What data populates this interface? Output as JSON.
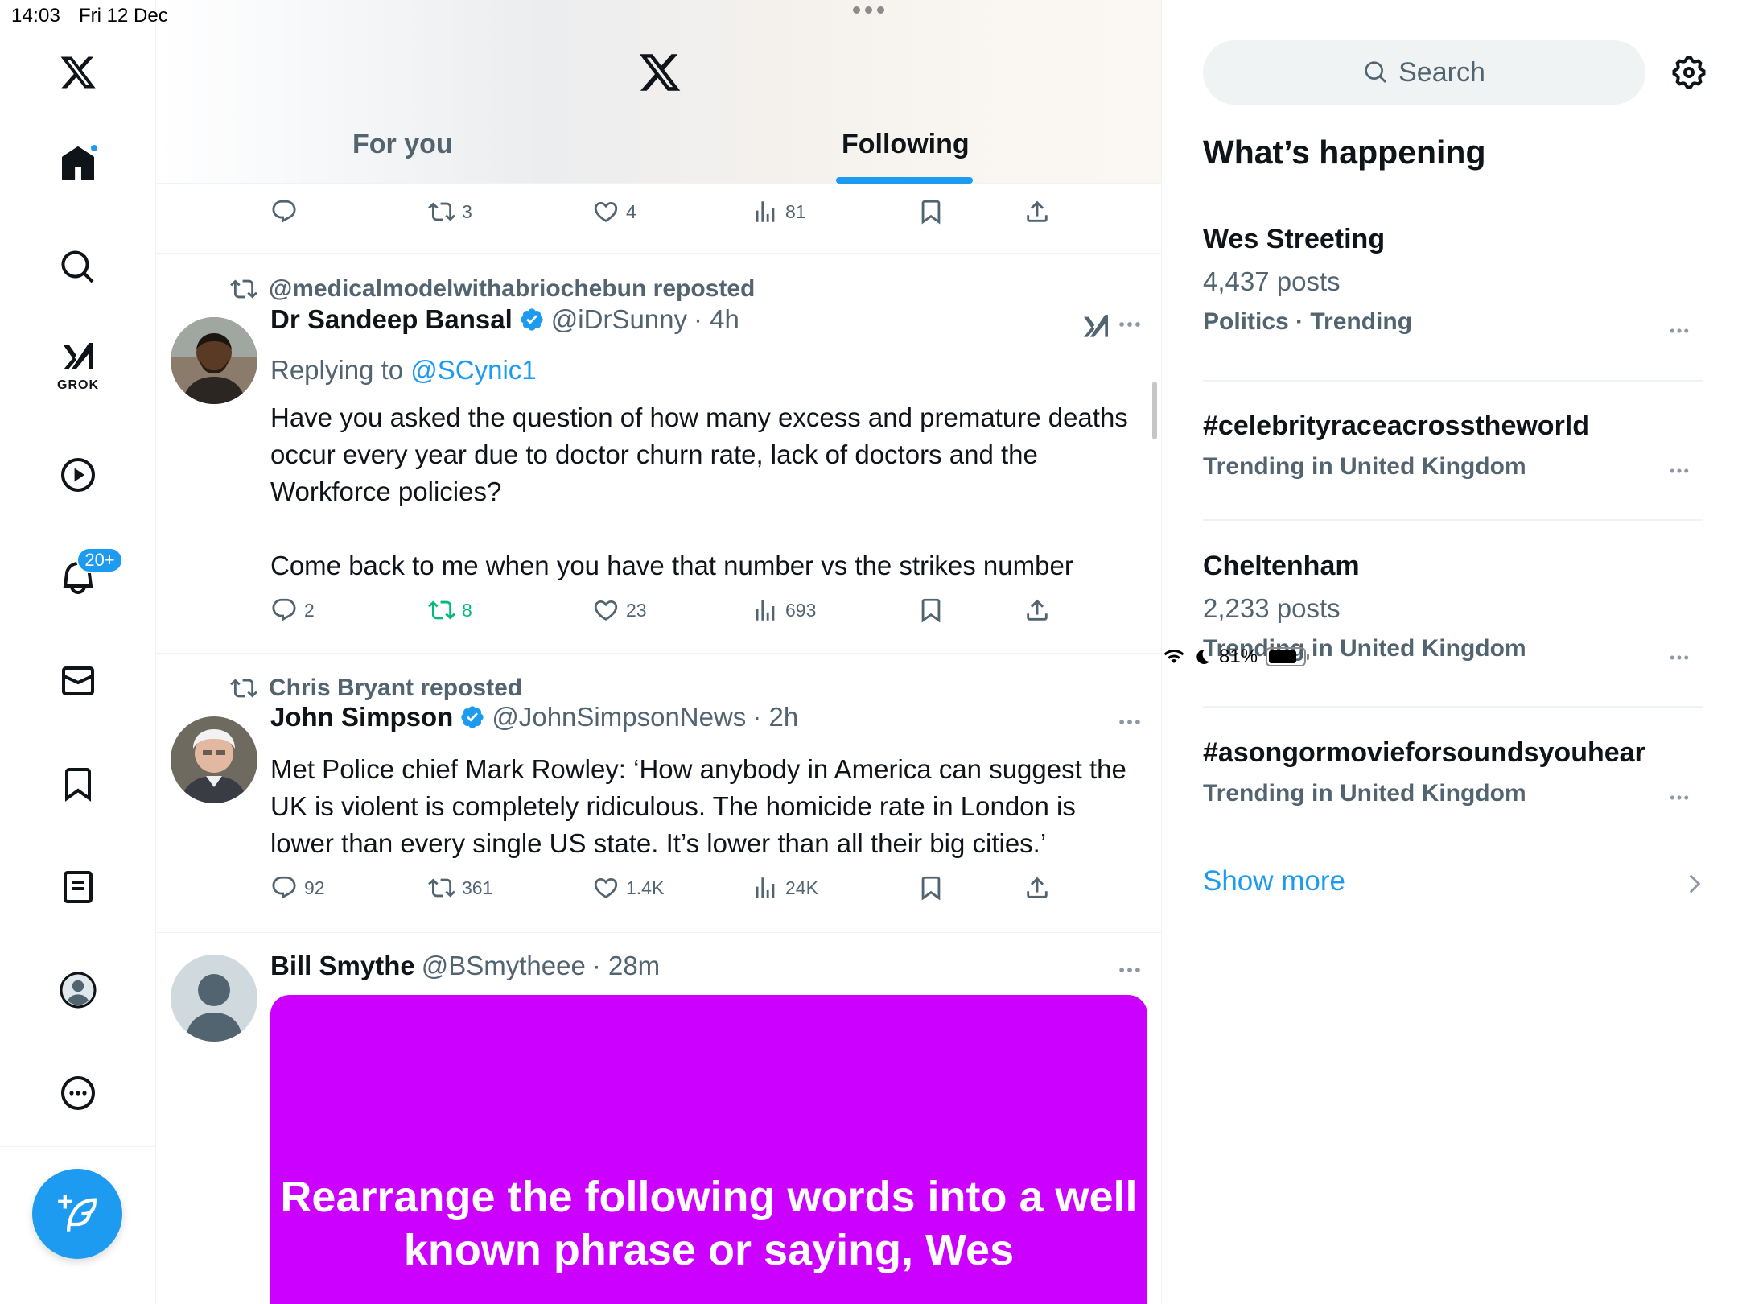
{
  "status_bar": {
    "time": "14:03",
    "date": "Fri 12 Dec",
    "battery": "81%",
    "battery_fraction": 0.81
  },
  "left_nav": {
    "items": [
      "x-logo",
      "home",
      "explore",
      "grok",
      "video",
      "notifications",
      "messages",
      "bookmarks",
      "lists",
      "profile",
      "more"
    ],
    "grok_label": "GROK",
    "notifications_badge": "20+",
    "home_has_dot": true
  },
  "timeline_header": {
    "tabs": [
      {
        "label": "For you",
        "active": false
      },
      {
        "label": "Following",
        "active": true
      }
    ]
  },
  "top_actions": {
    "replies": "",
    "reposts": "3",
    "likes": "4",
    "views": "81"
  },
  "tweets": [
    {
      "reposted_by": "@medicalmodelwithabriochebun reposted",
      "name": "Dr Sandeep Bansal",
      "handle": "@iDrSunny",
      "time": "· 4h",
      "replying_prefix": "Replying to ",
      "replying_to": "@SCynic1",
      "text": "Have you asked the question of how many excess and premature deaths occur every year due to doctor churn rate, lack of doctors and the Workforce policies?\n\nCome back to me when you have that number vs the strikes number",
      "replies": "2",
      "reposts": "8",
      "likes": "23",
      "views": "693"
    },
    {
      "reposted_by": "Chris Bryant reposted",
      "name": "John Simpson",
      "handle": "@JohnSimpsonNews",
      "time": "· 2h",
      "text": "Met Police chief Mark Rowley: ‘How anybody in America can suggest the UK is violent is completely ridiculous. The homicide rate in London is lower than every single US state. It’s lower than all their big cities.’",
      "replies": "92",
      "reposts": "361",
      "likes": "1.4K",
      "views": "24K"
    },
    {
      "name": "Bill Smythe",
      "handle": "@BSmytheee",
      "time": "· 28m",
      "media_text": "Rearrange the following words into a well known phrase or saying, Wes",
      "media_color": "#cc00ff"
    }
  ],
  "sidebar": {
    "search_placeholder": "Search",
    "section_title": "What’s happening",
    "trends": [
      {
        "name": "Wes Streeting",
        "count": "4,437 posts",
        "context": "Politics · Trending"
      },
      {
        "name": "#celebrityraceacrosstheworld",
        "count": "",
        "context": "Trending in United Kingdom"
      },
      {
        "name": "Cheltenham",
        "count": "2,233 posts",
        "context": "Trending in United Kingdom"
      },
      {
        "name": "#asongormovieforsoundsyouhear",
        "count": "",
        "context": "Trending in United Kingdom"
      }
    ],
    "show_more": "Show more"
  },
  "colors": {
    "accent": "#1d9bf0",
    "repost_active": "#00ba7c",
    "secondary_text": "#536471",
    "media_bg": "#cc00ff"
  }
}
